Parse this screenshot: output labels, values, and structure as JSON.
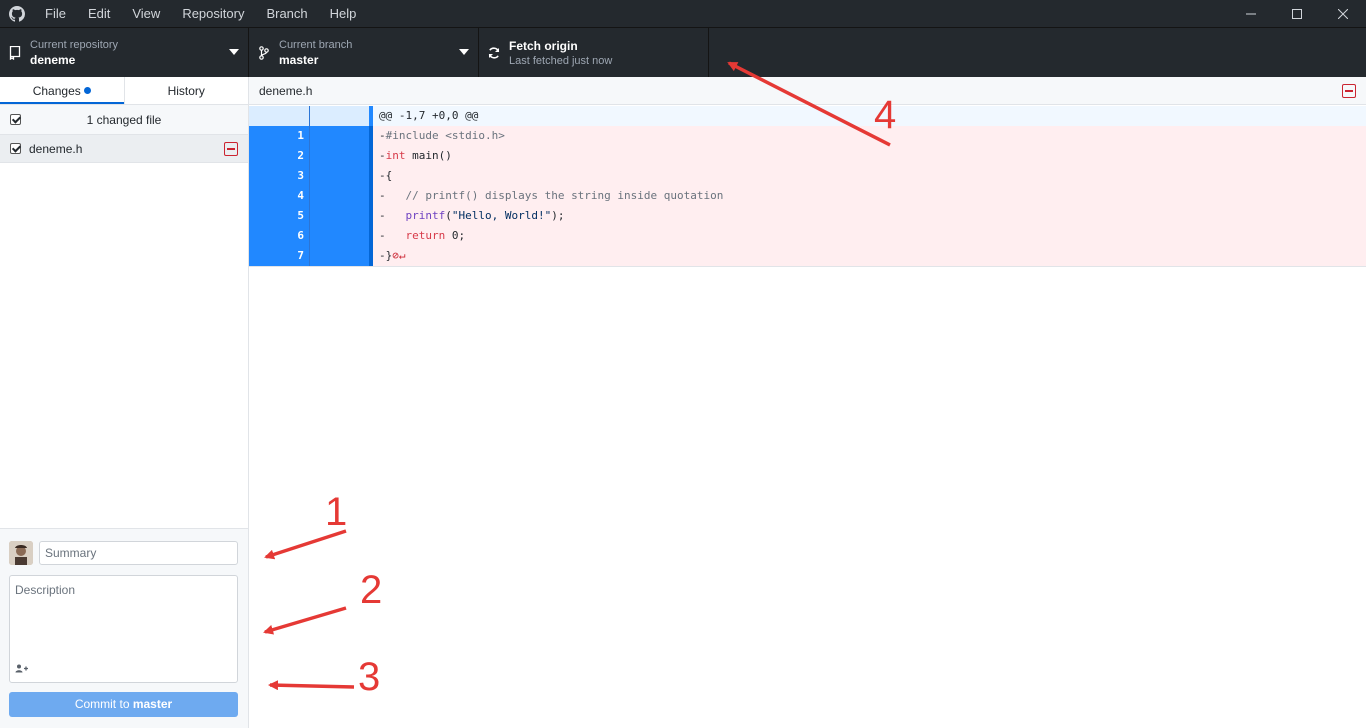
{
  "menu": [
    "File",
    "Edit",
    "View",
    "Repository",
    "Branch",
    "Help"
  ],
  "toolbar": {
    "repo": {
      "sub": "Current repository",
      "main": "deneme"
    },
    "branch": {
      "sub": "Current branch",
      "main": "master"
    },
    "fetch": {
      "main": "Fetch origin",
      "sub": "Last fetched just now"
    }
  },
  "tabs": {
    "changes": "Changes",
    "history": "History"
  },
  "changes": {
    "count_label": "1 changed file"
  },
  "files": [
    {
      "name": "deneme.h",
      "status": "deleted"
    }
  ],
  "diff": {
    "file": "deneme.h",
    "hunk": "@@ -1,7 +0,0 @@",
    "lines": [
      {
        "num": "1"
      },
      {
        "num": "2"
      },
      {
        "num": "3"
      },
      {
        "num": "4"
      },
      {
        "num": "5"
      },
      {
        "num": "6"
      },
      {
        "num": "7"
      }
    ]
  },
  "commit": {
    "summary_placeholder": "Summary",
    "description_placeholder": "Description",
    "button_prefix": "Commit to ",
    "button_branch": "master"
  },
  "annotations": [
    "1",
    "2",
    "3",
    "4"
  ],
  "colors": {
    "accent": "#0366d6",
    "removed_bg": "#ffeef0",
    "annotation": "#e53935",
    "titlebar": "#24292e"
  }
}
